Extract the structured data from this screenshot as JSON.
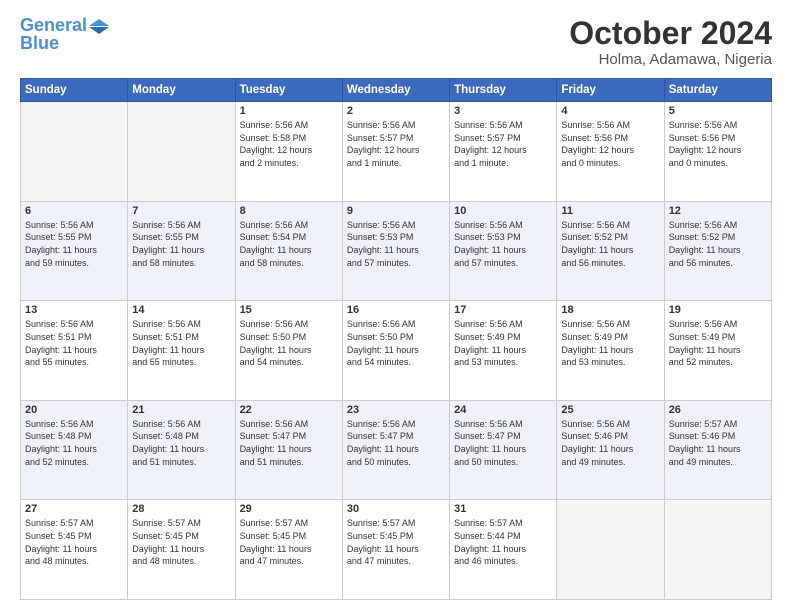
{
  "header": {
    "logo_line1": "General",
    "logo_line2": "Blue",
    "month": "October 2024",
    "location": "Holma, Adamawa, Nigeria"
  },
  "days_of_week": [
    "Sunday",
    "Monday",
    "Tuesday",
    "Wednesday",
    "Thursday",
    "Friday",
    "Saturday"
  ],
  "weeks": [
    [
      {
        "day": "",
        "detail": ""
      },
      {
        "day": "",
        "detail": ""
      },
      {
        "day": "1",
        "detail": "Sunrise: 5:56 AM\nSunset: 5:58 PM\nDaylight: 12 hours\nand 2 minutes."
      },
      {
        "day": "2",
        "detail": "Sunrise: 5:56 AM\nSunset: 5:57 PM\nDaylight: 12 hours\nand 1 minute."
      },
      {
        "day": "3",
        "detail": "Sunrise: 5:56 AM\nSunset: 5:57 PM\nDaylight: 12 hours\nand 1 minute."
      },
      {
        "day": "4",
        "detail": "Sunrise: 5:56 AM\nSunset: 5:56 PM\nDaylight: 12 hours\nand 0 minutes."
      },
      {
        "day": "5",
        "detail": "Sunrise: 5:56 AM\nSunset: 5:56 PM\nDaylight: 12 hours\nand 0 minutes."
      }
    ],
    [
      {
        "day": "6",
        "detail": "Sunrise: 5:56 AM\nSunset: 5:55 PM\nDaylight: 11 hours\nand 59 minutes."
      },
      {
        "day": "7",
        "detail": "Sunrise: 5:56 AM\nSunset: 5:55 PM\nDaylight: 11 hours\nand 58 minutes."
      },
      {
        "day": "8",
        "detail": "Sunrise: 5:56 AM\nSunset: 5:54 PM\nDaylight: 11 hours\nand 58 minutes."
      },
      {
        "day": "9",
        "detail": "Sunrise: 5:56 AM\nSunset: 5:53 PM\nDaylight: 11 hours\nand 57 minutes."
      },
      {
        "day": "10",
        "detail": "Sunrise: 5:56 AM\nSunset: 5:53 PM\nDaylight: 11 hours\nand 57 minutes."
      },
      {
        "day": "11",
        "detail": "Sunrise: 5:56 AM\nSunset: 5:52 PM\nDaylight: 11 hours\nand 56 minutes."
      },
      {
        "day": "12",
        "detail": "Sunrise: 5:56 AM\nSunset: 5:52 PM\nDaylight: 11 hours\nand 56 minutes."
      }
    ],
    [
      {
        "day": "13",
        "detail": "Sunrise: 5:56 AM\nSunset: 5:51 PM\nDaylight: 11 hours\nand 55 minutes."
      },
      {
        "day": "14",
        "detail": "Sunrise: 5:56 AM\nSunset: 5:51 PM\nDaylight: 11 hours\nand 55 minutes."
      },
      {
        "day": "15",
        "detail": "Sunrise: 5:56 AM\nSunset: 5:50 PM\nDaylight: 11 hours\nand 54 minutes."
      },
      {
        "day": "16",
        "detail": "Sunrise: 5:56 AM\nSunset: 5:50 PM\nDaylight: 11 hours\nand 54 minutes."
      },
      {
        "day": "17",
        "detail": "Sunrise: 5:56 AM\nSunset: 5:49 PM\nDaylight: 11 hours\nand 53 minutes."
      },
      {
        "day": "18",
        "detail": "Sunrise: 5:56 AM\nSunset: 5:49 PM\nDaylight: 11 hours\nand 53 minutes."
      },
      {
        "day": "19",
        "detail": "Sunrise: 5:56 AM\nSunset: 5:49 PM\nDaylight: 11 hours\nand 52 minutes."
      }
    ],
    [
      {
        "day": "20",
        "detail": "Sunrise: 5:56 AM\nSunset: 5:48 PM\nDaylight: 11 hours\nand 52 minutes."
      },
      {
        "day": "21",
        "detail": "Sunrise: 5:56 AM\nSunset: 5:48 PM\nDaylight: 11 hours\nand 51 minutes."
      },
      {
        "day": "22",
        "detail": "Sunrise: 5:56 AM\nSunset: 5:47 PM\nDaylight: 11 hours\nand 51 minutes."
      },
      {
        "day": "23",
        "detail": "Sunrise: 5:56 AM\nSunset: 5:47 PM\nDaylight: 11 hours\nand 50 minutes."
      },
      {
        "day": "24",
        "detail": "Sunrise: 5:56 AM\nSunset: 5:47 PM\nDaylight: 11 hours\nand 50 minutes."
      },
      {
        "day": "25",
        "detail": "Sunrise: 5:56 AM\nSunset: 5:46 PM\nDaylight: 11 hours\nand 49 minutes."
      },
      {
        "day": "26",
        "detail": "Sunrise: 5:57 AM\nSunset: 5:46 PM\nDaylight: 11 hours\nand 49 minutes."
      }
    ],
    [
      {
        "day": "27",
        "detail": "Sunrise: 5:57 AM\nSunset: 5:45 PM\nDaylight: 11 hours\nand 48 minutes."
      },
      {
        "day": "28",
        "detail": "Sunrise: 5:57 AM\nSunset: 5:45 PM\nDaylight: 11 hours\nand 48 minutes."
      },
      {
        "day": "29",
        "detail": "Sunrise: 5:57 AM\nSunset: 5:45 PM\nDaylight: 11 hours\nand 47 minutes."
      },
      {
        "day": "30",
        "detail": "Sunrise: 5:57 AM\nSunset: 5:45 PM\nDaylight: 11 hours\nand 47 minutes."
      },
      {
        "day": "31",
        "detail": "Sunrise: 5:57 AM\nSunset: 5:44 PM\nDaylight: 11 hours\nand 46 minutes."
      },
      {
        "day": "",
        "detail": ""
      },
      {
        "day": "",
        "detail": ""
      }
    ]
  ]
}
